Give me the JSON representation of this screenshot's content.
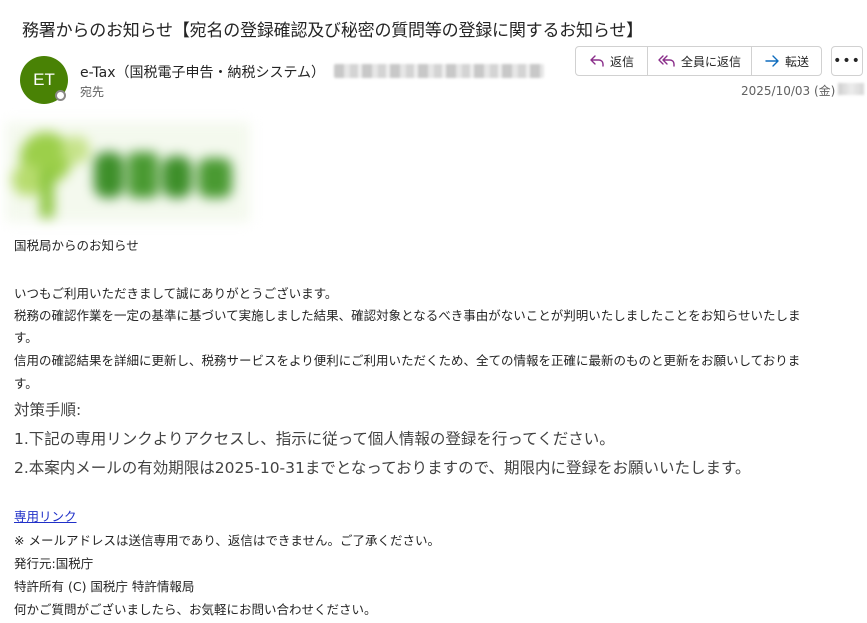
{
  "email": {
    "subject": "務署からのお知らせ【宛名の登録確認及び秘密の質問等の登録に関するお知らせ】",
    "sender_initials": "ET",
    "sender_name": "e-Tax（国税電子申告・納税システム）",
    "to_label": "宛先",
    "date": "2025/10/03 (金)",
    "avatar_color": "#498205"
  },
  "actions": {
    "reply": "返信",
    "reply_all": "全員に返信",
    "forward": "転送",
    "more": "•••",
    "icon_color": "#8a2e8a",
    "forward_icon_color": "#0f6cbd"
  },
  "body": {
    "greeting": "国税局からのお知らせ",
    "line1": "いつもご利用いただきまして誠にありがとうございます。",
    "line2": "税務の確認作業を一定の基準に基づいて実施しました結果、確認対象となるべき事由がないことが判明いたしましたことをお知らせいたしま",
    "line2b": "す。",
    "line3": "信用の確認結果を詳細に更新し、税務サービスをより便利にご利用いただくため、全ての情報を正確に最新のものと更新をお願いしておりま",
    "line3b": "す。",
    "steps_title": "対策手順:",
    "step1": "1.下記の専用リンクよりアクセスし、指示に従って個人情報の登録を行ってください。",
    "step2": "2.本案内メールの有効期限は2025-10-31までとなっておりますので、期限内に登録をお願いいたします。",
    "link_text": "専用リンク",
    "note": "※ メールアドレスは送信専用であり、返信はできません。ご了承ください。",
    "issuer": "発行元:国税庁",
    "copyright": "特許所有 (C) 国税庁 特許情報局",
    "contact": "何かご質問がございましたら、お気軽にお問い合わせください。"
  }
}
